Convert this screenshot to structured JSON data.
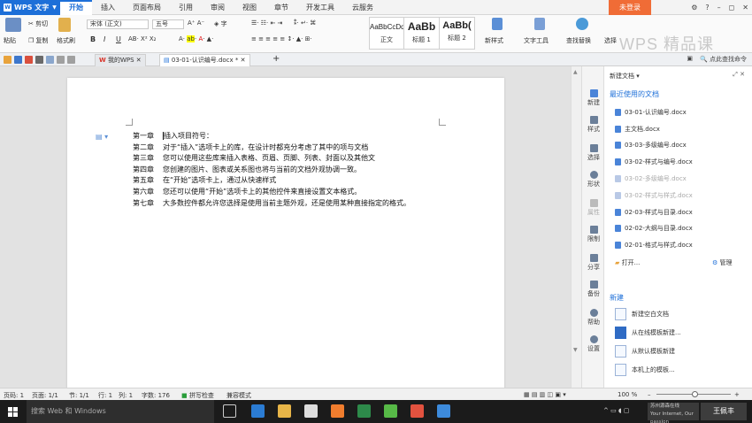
{
  "app": {
    "name": "WPS 文字",
    "logo": "W"
  },
  "menu_tabs": [
    "开始",
    "插入",
    "页面布局",
    "引用",
    "审阅",
    "视图",
    "章节",
    "开发工具",
    "云服务"
  ],
  "login_label": "未登录",
  "window_controls": [
    "⚙",
    "?",
    "–",
    "◻",
    "✕"
  ],
  "ribbon": {
    "paste": "粘贴",
    "cut": "剪切",
    "copy": "复制",
    "format_painter": "格式刷",
    "font_name": "宋体 (正文)",
    "font_size": "五号",
    "bold": "B",
    "italic": "I",
    "underline": "U",
    "styles": [
      {
        "preview": "AaBbCcDd",
        "name": "正文"
      },
      {
        "preview": "AaBb",
        "name": "标题 1"
      },
      {
        "preview": "AaBb(",
        "name": "标题 2"
      }
    ],
    "new_style": "新样式",
    "text_tools": "文字工具",
    "find_replace": "查找替换",
    "select": "选择"
  },
  "watermark": "WPS 精品课",
  "tabs": [
    {
      "label": "我的WPS",
      "active": false
    },
    {
      "label": "03-01-认识编号.docx *",
      "active": true
    }
  ],
  "tab_add": "+",
  "toolbar_right": {
    "search": "点此查找命令"
  },
  "document": {
    "lines": [
      {
        "chapter": "第一章",
        "text": "插入项目符号："
      },
      {
        "chapter": "第二章",
        "text": "对于“插入”选项卡上的库，在设计时都充分考虑了其中的项与文档"
      },
      {
        "chapter": "第三章",
        "text": "您可以使用这些库来插入表格、页眉、页脚、列表、封面以及其他文"
      },
      {
        "chapter": "第四章",
        "text": "您创建的图片、图表或关系图也将与当前的文档外观协调一致。"
      },
      {
        "chapter": "第五章",
        "text": "在“开始”选项卡上，通过从快速样式"
      },
      {
        "chapter": "第六章",
        "text": "您还可以使用“开始”选项卡上的其他控件来直接设置文本格式。"
      },
      {
        "chapter": "第七章",
        "text": "大多数控件都允许您选择是使用当前主题外观，还是使用某种直接指定的格式。"
      }
    ]
  },
  "side_strip": [
    "新建",
    "样式",
    "选择",
    "形状",
    "属性",
    "限制",
    "分享",
    "备份",
    "帮助",
    "设置"
  ],
  "panel": {
    "title": "新建文档",
    "recent_header": "最近使用的文档",
    "recent": [
      {
        "name": "03-01-认识编号.docx",
        "dim": false
      },
      {
        "name": "主文档.docx",
        "dim": false
      },
      {
        "name": "03-03-多级编号.docx",
        "dim": false
      },
      {
        "name": "03-02-样式与编号.docx",
        "dim": false
      },
      {
        "name": "03-02-多级编号.docx",
        "dim": true
      },
      {
        "name": "03-02-样式与样式.docx",
        "dim": true
      },
      {
        "name": "02-03-样式与目录.docx",
        "dim": false
      },
      {
        "name": "02-02-大纲与目录.docx",
        "dim": false
      },
      {
        "name": "02-01-格式与样式.docx",
        "dim": false
      }
    ],
    "open": "打开...",
    "manage": "管理",
    "new_header": "新建",
    "new_items": [
      "新建空白文档",
      "从在线模板新建...",
      "从默认模板新建",
      "本机上的模板..."
    ]
  },
  "status": {
    "page": "页码: 1",
    "pages": "页面: 1/1",
    "section": "节: 1/1",
    "row": "行: 1",
    "col": "列: 1",
    "words": "字数: 176",
    "spell": "拼写检查",
    "compat": "兼容模式",
    "zoom": "100 %"
  },
  "taskbar": {
    "search": "搜索 Web 和 Windows",
    "notice_line1": "苏州源森在线",
    "notice_line2": "Your Internet, Our passion",
    "user": "王佩丰"
  }
}
